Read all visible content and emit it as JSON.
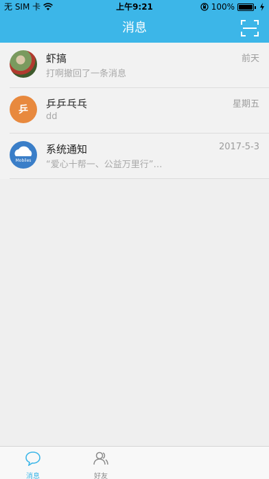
{
  "status_bar": {
    "carrier": "无 SIM 卡",
    "time": "上午9:21",
    "battery": "100%"
  },
  "nav": {
    "title": "消息",
    "scan_icon": "scan-icon"
  },
  "colors": {
    "accent": "#3cb6e8",
    "orange_avatar": "#e8893e",
    "cloud_avatar": "#3a7ec8"
  },
  "conversations": [
    {
      "name": "虾搞",
      "preview": "打啊撤回了一条消息",
      "time": "前天",
      "avatar": "photo-avatar"
    },
    {
      "name": "乒乒乓乓",
      "preview": "dd",
      "time": "星期五",
      "avatar": "text-avatar",
      "avatar_text": "乒"
    },
    {
      "name": "系统通知",
      "preview": "“爱心十帮一、公益万里行”…",
      "time": "2017-5-3",
      "avatar": "cloud-avatar",
      "avatar_text": "Mobiles"
    }
  ],
  "tabs": [
    {
      "label": "消息",
      "icon": "chat-bubble-icon",
      "active": true
    },
    {
      "label": "好友",
      "icon": "contacts-icon",
      "active": false
    }
  ]
}
